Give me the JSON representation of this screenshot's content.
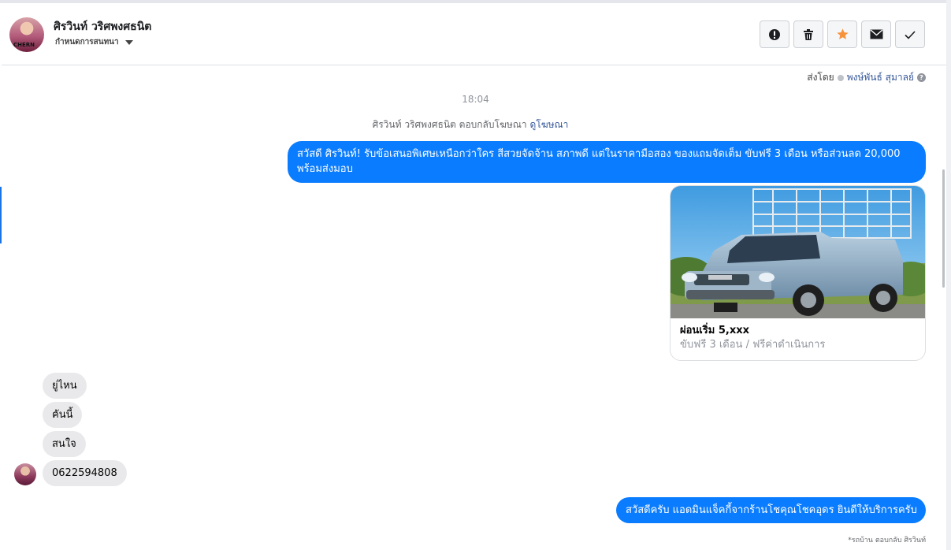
{
  "header": {
    "name": "ศิรวินท์ วริศพงศธนิต",
    "subtitle": "กำหนดการสนทนา",
    "avatar_caption": "CHERN"
  },
  "toolbar": {
    "icons": [
      "alert-icon",
      "trash-icon",
      "star-icon",
      "mail-icon",
      "check-icon"
    ],
    "star_color": "#f7923b"
  },
  "sent_by": {
    "prefix": "ส่งโดย",
    "name": "พงษ์พันธ์ สุมาลย์",
    "help": "?"
  },
  "conversation": {
    "timestamp": "18:04",
    "ad_reply_prefix": "ศิรวินท์ วริศพงศธนิต ตอบกลับโฆษณา",
    "ad_reply_link": "ดูโฆษณา",
    "outgoing_first": "สวัสดี ศิรวินท์! รับข้อเสนอพิเศษเหนือกว่าใคร สีสวยจัดจ้าน สภาพดี แต่ในราคามือสอง ของแถมจัดเต็ม ขับฟรี 3 เดือน หรือส่วนลด 20,000 พร้อมส่งมอบ",
    "ad_card": {
      "title": "ผ่อนเริ่ม 5,xxx",
      "subtitle": "ขับฟรี 3 เดือน / ฟรีค่าดำเนินการ",
      "image": "pickup-truck-photo"
    },
    "incoming": [
      "ยู่ไหน",
      "คันนี้",
      "สนใจ",
      "0622594808"
    ],
    "outgoing_last": "สวัสดีครับ แอดมินแจ็คกี้จากร้านโชคุณโชคอุดร ยินดีให้บริการครับ",
    "footnote": "*รถบ้าน ตอบกลับ ศิรวินท์"
  },
  "colors": {
    "outgoing_bubble": "#0a7cff",
    "incoming_bubble": "#e9e9eb",
    "link": "#365899"
  }
}
